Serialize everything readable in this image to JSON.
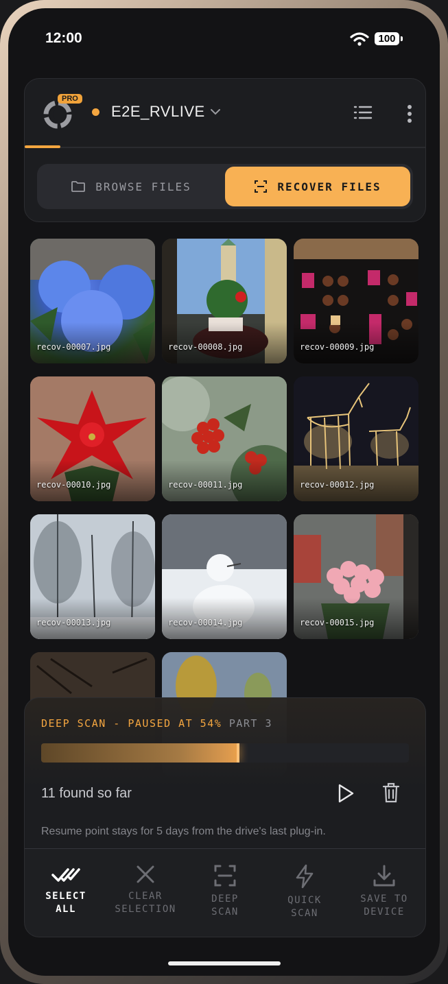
{
  "status_bar": {
    "time": "12:00",
    "battery": "100"
  },
  "header": {
    "pro_badge": "PRO",
    "drive_name": "E2E_RVLIVE",
    "accent": "#f4a640"
  },
  "tabs": {
    "browse_label": "BROWSE FILES",
    "recover_label": "RECOVER FILES",
    "active": "recover"
  },
  "files": [
    {
      "name": "recov-00007.jpg"
    },
    {
      "name": "recov-00008.jpg"
    },
    {
      "name": "recov-00009.jpg"
    },
    {
      "name": "recov-00010.jpg"
    },
    {
      "name": "recov-00011.jpg"
    },
    {
      "name": "recov-00012.jpg"
    },
    {
      "name": "recov-00013.jpg"
    },
    {
      "name": "recov-00014.jpg"
    },
    {
      "name": "recov-00015.jpg"
    }
  ],
  "scan": {
    "status": "DEEP SCAN - PAUSED AT 54%",
    "part": "PART 3",
    "progress": 0.54,
    "found": "11 found so far",
    "note": "Resume point stays for 5 days from the drive's last plug-in."
  },
  "toolbar": {
    "select_all": "SELECT\nALL",
    "clear_selection": "CLEAR\nSELECTION",
    "deep_scan": "DEEP\nSCAN",
    "quick_scan": "QUICK\nSCAN",
    "save_to_device": "SAVE TO\nDEVICE"
  },
  "icons": [
    "wifi-icon",
    "app-logo-icon",
    "chevron-down-icon",
    "list-icon",
    "more-vertical-icon",
    "folder-icon",
    "scan-icon",
    "play-icon",
    "trash-icon",
    "double-check-icon",
    "close-icon",
    "bolt-icon",
    "download-icon"
  ]
}
